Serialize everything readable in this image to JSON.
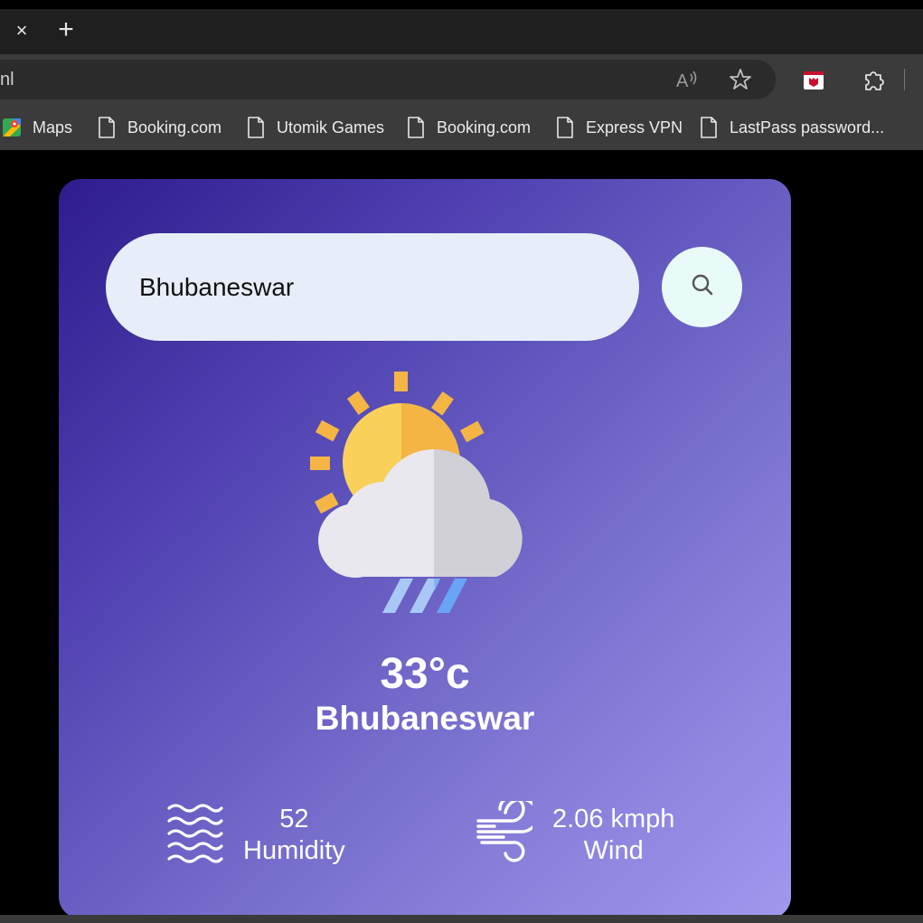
{
  "browser": {
    "tab_close_glyph": "×",
    "new_tab_glyph": "+",
    "address_text": "nl",
    "bookmarks": [
      {
        "label": "Maps",
        "icon": "maps-icon"
      },
      {
        "label": "Booking.com",
        "icon": "page-icon"
      },
      {
        "label": "Utomik Games",
        "icon": "page-icon"
      },
      {
        "label": "Booking.com",
        "icon": "page-icon"
      },
      {
        "label": "Express VPN",
        "icon": "page-icon"
      },
      {
        "label": "LastPass password...",
        "icon": "page-icon"
      }
    ]
  },
  "app": {
    "search": {
      "value": "Bhubaneswar",
      "icon": "search-icon"
    },
    "weather": {
      "icon": "sun-cloud-rain-icon",
      "temperature": "33°c",
      "city": "Bhubaneswar"
    },
    "humidity": {
      "value": "52",
      "label": "Humidity",
      "icon": "waves-icon"
    },
    "wind": {
      "value": "2.06 kmph",
      "label": "Wind",
      "icon": "wind-icon"
    }
  }
}
